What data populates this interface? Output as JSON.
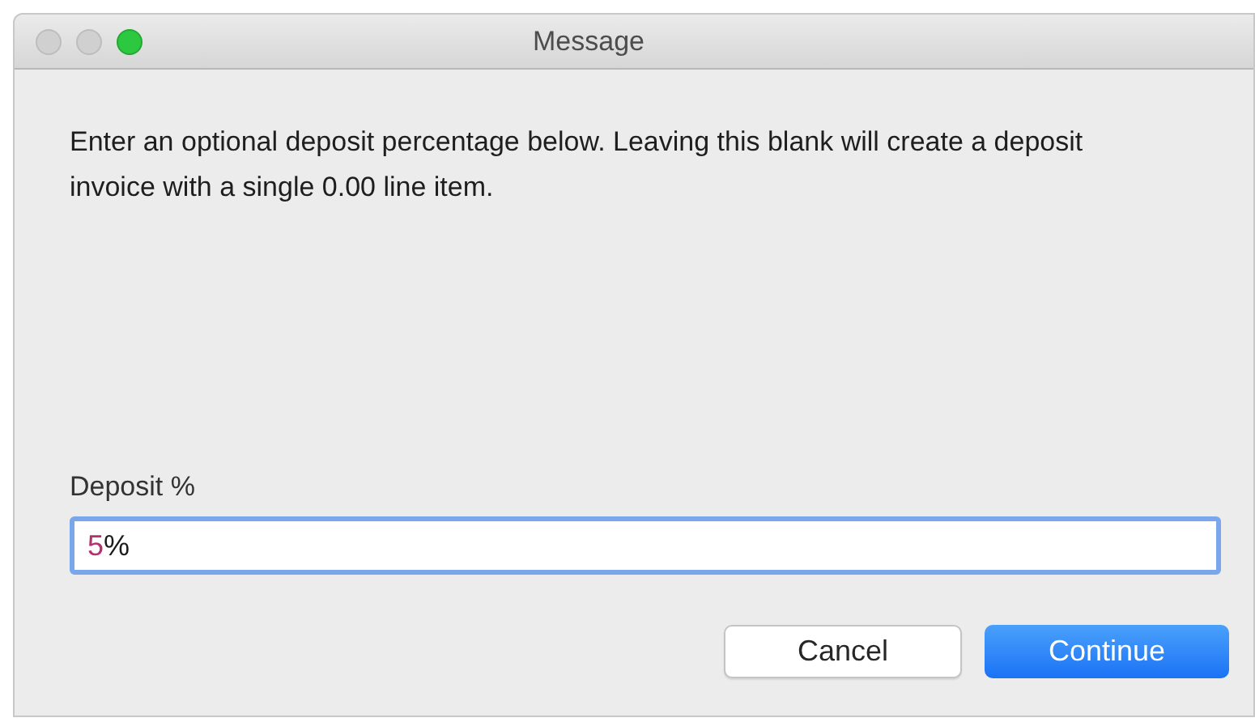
{
  "window": {
    "title": "Message"
  },
  "message": "Enter an optional deposit percentage below. Leaving this blank will create a deposit invoice with a single 0.00 line item.",
  "field": {
    "label": "Deposit %",
    "focused": true,
    "value_parts": [
      {
        "text": "5",
        "color": "#b5306f"
      },
      {
        "text": "%",
        "color": "#1a1a1a"
      }
    ]
  },
  "buttons": [
    {
      "label": "Cancel",
      "default": false
    },
    {
      "label": "Continue",
      "default": true
    }
  ]
}
